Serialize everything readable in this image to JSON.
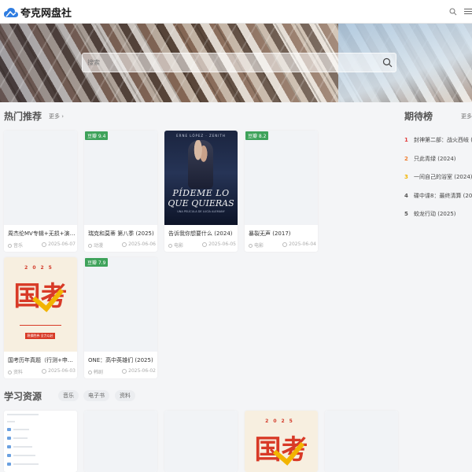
{
  "header": {
    "logo_text": "夸克网盘社",
    "brand_color": "#1a1a1a"
  },
  "banner": {
    "search_placeholder": "搜索"
  },
  "hot": {
    "title": "热门推荐",
    "more": "更多",
    "cards": [
      {
        "title": "周杰伦MV专辑+无损+演唱会",
        "category": "音乐",
        "date": "2025-06-07",
        "badge": ""
      },
      {
        "title": "瑞克和莫蒂 第八季 (2025)",
        "category": "动漫",
        "date": "2025-06-06",
        "badge": "豆瓣 9.4"
      },
      {
        "title": "告诉我你想要什么 (2024)",
        "category": "电影",
        "date": "2025-06-05",
        "badge": ""
      },
      {
        "title": "暴裂无声 (2017)",
        "category": "电影",
        "date": "2025-06-04",
        "badge": "豆瓣 8.2"
      },
      {
        "title": "国考历年真题（行测+申论）",
        "category": "资料",
        "date": "2025-06-03",
        "badge": ""
      },
      {
        "title": "ONE：高中英雄们 (2025)",
        "category": "韩剧",
        "date": "2025-06-02",
        "badge": "豆瓣 7.9"
      }
    ],
    "movie_poster": {
      "top": "ERNE LÓPEZ · ZENITH",
      "title_line1": "PÍDEME LO",
      "title_line2": "QUE QUIERAS",
      "sub": "UNA PELÍCULA DE LUCÍA ALEMANY"
    },
    "exam_poster": {
      "year": "2025",
      "big": "国考",
      "tag": "稳操胜券 全力以赴"
    }
  },
  "ranking": {
    "title": "期待榜",
    "more": "更多",
    "items": [
      {
        "rank": "1",
        "text": "封神第二部：战火西岐 (2025)",
        "color": "#e23c3c"
      },
      {
        "rank": "2",
        "text": "只此青绿 (2024)",
        "color": "#f07d2e"
      },
      {
        "rank": "3",
        "text": "一间自己的浴室 (2024)",
        "color": "#f2b400"
      },
      {
        "rank": "4",
        "text": "碟中谍8：最终清算 (2025)",
        "color": "#555555"
      },
      {
        "rank": "5",
        "text": "蛟龙行动 (2025)",
        "color": "#555555"
      }
    ]
  },
  "study": {
    "title": "学习资源",
    "tags": [
      "音乐",
      "电子书",
      "资料"
    ]
  }
}
